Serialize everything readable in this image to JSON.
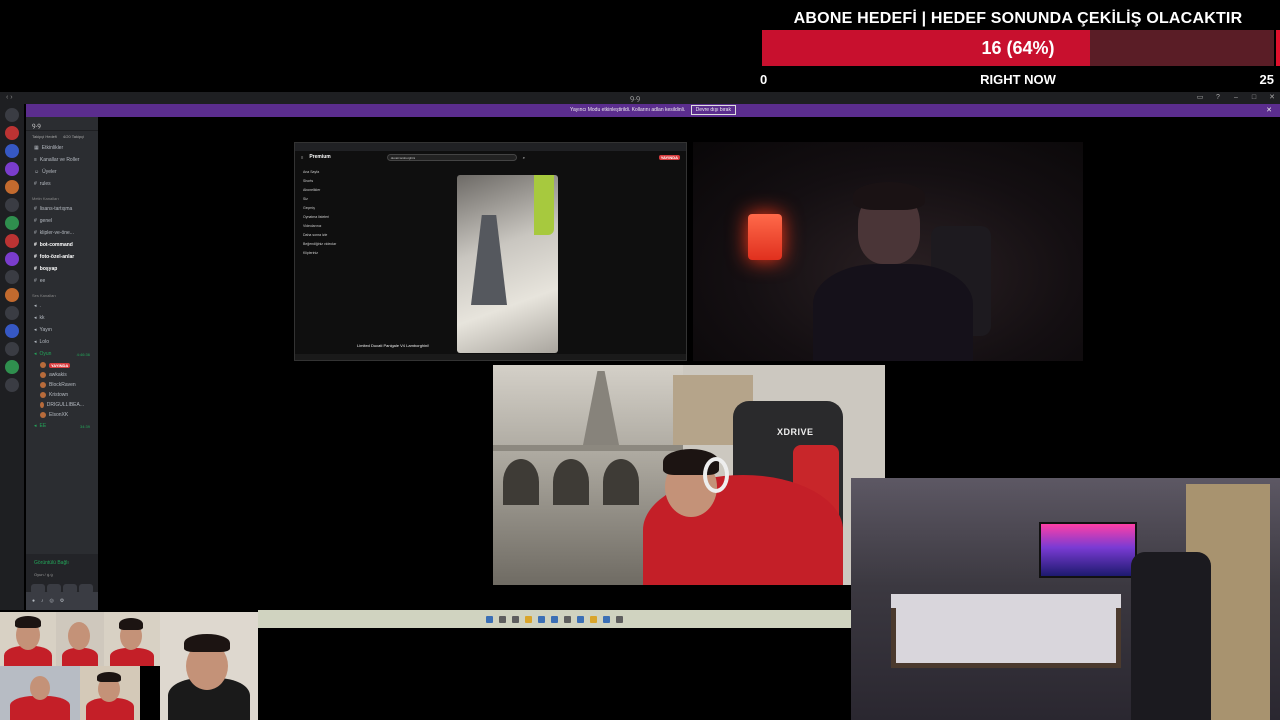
{
  "goal": {
    "title": "ABONE HEDEFİ | HEDEF SONUNDA ÇEKİLİŞ OLACAKTIR",
    "value_text": "16 (64%)",
    "current": 16,
    "target": 25,
    "progress": 0.64,
    "min_label": "0",
    "max_label": "25",
    "status_label": "RIGHT NOW",
    "colors": {
      "fill": "#c8102e",
      "track": "#5a1d26"
    }
  },
  "window": {
    "title": "ꝯ.ꝯ",
    "banner_text": "Yayıncı Modu etkinleştirildi. Kollarını adlan kesildinli.",
    "banner_button": "Devre dışı bırak"
  },
  "sidebar": {
    "server_name": "ꝯ.ꝯ",
    "tabs": [
      "Takipçi Hedefi",
      "4/20 Takipçi"
    ],
    "top_items": [
      "Etkinlikler",
      "Kanallar ve Roller",
      "Üyeler"
    ],
    "categories": [
      "Metin Kanalları",
      "Ses Kanalları"
    ],
    "text_channels": [
      "rules",
      "lisans-tartışma",
      "genel",
      "klipler-ve-öne...",
      "bot-command",
      "foto-özel-anlar",
      "boşyap",
      "ee"
    ],
    "voice_channels": [
      ".",
      "kk",
      "Yayın",
      "Lolo",
      "Oyun"
    ],
    "voice_timer": "4:46:36",
    "voice_users": [
      "LIVE",
      "awkakis",
      "BlockRaven",
      "Kristown",
      "DRIGULLIBEA...",
      "ElsonXK"
    ],
    "live_label": "YAYINDA",
    "second_voice": "EE",
    "second_timer": "34:39",
    "status_title": "Görüntülü Bağlı",
    "status_sub": "Oyun / ꝯ.ꝯ"
  },
  "screen_share": {
    "brand": "Premium",
    "search_text": "ducati lamborghini",
    "live_badge": "YAYINDA",
    "side_items": [
      "Ana Sayfa",
      "Shorts",
      "Abonelikler",
      "Siz",
      "Geçmiş",
      "Oynatma listeleri",
      "Videolarınız",
      "Daha sonra izle",
      "Beğendiğiniz videolar",
      "Klipleriniz"
    ],
    "short_title": "Limited Ducati Panigale V4 Lamborghini!"
  },
  "cam2": {
    "chair_brand": "XDRIVE"
  },
  "icons": [
    "window-minimize-icon",
    "window-maximize-icon",
    "close-icon",
    "speaker-icon",
    "camera-icon",
    "gear-icon"
  ]
}
